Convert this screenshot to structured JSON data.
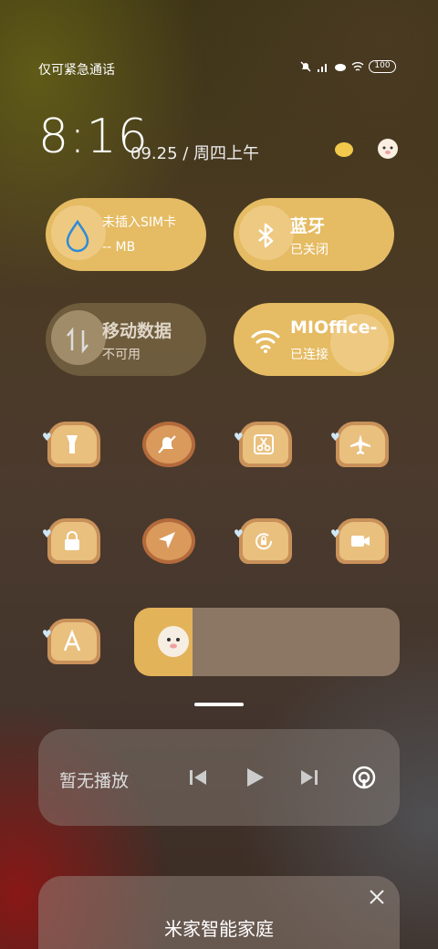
{
  "status_bar": {
    "carrier_text": "仅可紧急通话",
    "battery": "100",
    "icons": [
      "bell-slash-icon",
      "signal-icon",
      "cloud-icon",
      "wifi-icon",
      "battery-icon"
    ]
  },
  "header": {
    "time": "8:16",
    "date": "09.25 / 周四上午"
  },
  "tiles": {
    "data_usage": {
      "title": "未插入SIM卡",
      "sub": "-- MB"
    },
    "bluetooth": {
      "title": "蓝牙",
      "sub": "已关闭"
    },
    "mobile_data": {
      "title": "移动数据",
      "sub": "不可用"
    },
    "wifi": {
      "title": "MIOffice-",
      "sub": "已连接"
    }
  },
  "quick_toggles": [
    "flashlight-icon",
    "mute-icon",
    "screenshot-icon",
    "airplane-icon",
    "lock-icon",
    "location-icon",
    "rotation-lock-icon",
    "video-icon",
    "font-icon"
  ],
  "brightness": {
    "level": 0.22
  },
  "media": {
    "status": "暂无播放"
  },
  "smart_home": {
    "title": "米家智能家庭"
  },
  "colors": {
    "accent": "#e5bb63",
    "toast": "#e9c07e"
  }
}
